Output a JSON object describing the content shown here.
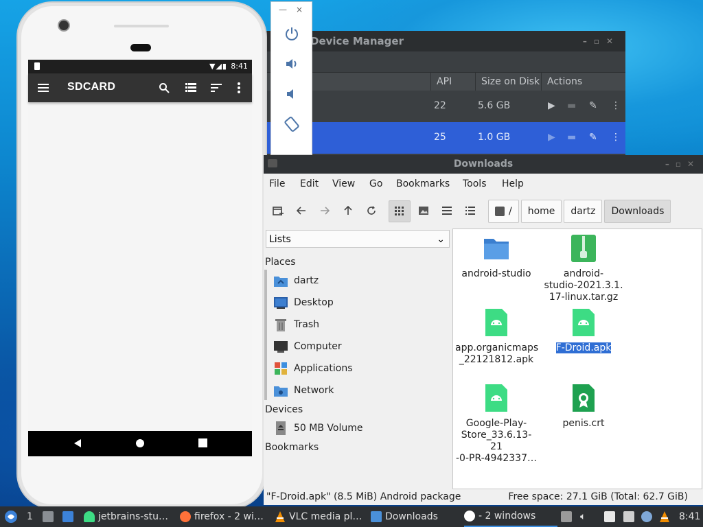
{
  "device_manager": {
    "title": "Device Manager",
    "columns": {
      "api": "API",
      "size": "Size on Disk",
      "actions": "Actions"
    },
    "rows": [
      {
        "api": "22",
        "size": "5.6 GB"
      },
      {
        "api": "25",
        "size": "1.0 GB"
      }
    ]
  },
  "emulator_toolbar": {
    "minimize": "—",
    "close": "×"
  },
  "phone": {
    "time": "8:41",
    "app_title": "SDCARD"
  },
  "file_manager": {
    "title": "Downloads",
    "menu": [
      "File",
      "Edit",
      "View",
      "Go",
      "Bookmarks",
      "Tools",
      "Help"
    ],
    "breadcrumbs": [
      "/",
      "home",
      "dartz",
      "Downloads"
    ],
    "side_select": "Lists",
    "sections": {
      "places": "Places",
      "devices": "Devices",
      "bookmarks": "Bookmarks"
    },
    "places": [
      "dartz",
      "Desktop",
      "Trash",
      "Computer",
      "Applications",
      "Network"
    ],
    "devices": [
      "50 MB Volume"
    ],
    "files": [
      {
        "line1": "android-studio",
        "line2": "",
        "line3": "",
        "icon": "folder-icon"
      },
      {
        "line1": "android-",
        "line2": "studio-2021.3.1.",
        "line3": "17-linux.tar.gz",
        "icon": "archive-icon"
      },
      {
        "line1": "app.organicmaps",
        "line2": "_22121812.apk",
        "line3": "",
        "icon": "apk-icon"
      },
      {
        "line1": "F-Droid.apk",
        "line2": "",
        "line3": "",
        "icon": "apk-icon"
      },
      {
        "line1": "Google-Play-",
        "line2": "Store_33.6.13-21",
        "line3": "-0-PR-4942337…",
        "icon": "apk-icon"
      },
      {
        "line1": "penis.crt",
        "line2": "",
        "line3": "",
        "icon": "certificate-icon"
      }
    ],
    "status_left": "\"F-Droid.apk\" (8.5 MiB) Android package",
    "status_right": "Free space: 27.1 GiB (Total: 62.7 GiB)"
  },
  "taskbar": {
    "workspace": "1",
    "tasks": [
      "jetbrains-stu…",
      "firefox - 2 wi…",
      "VLC media pl…",
      "Downloads",
      "- 2 windows"
    ],
    "clock": "8:41"
  },
  "colors": {
    "accent": "#2f6ed4",
    "apk_green": "#3ddc84",
    "folder_blue": "#4a90d9"
  }
}
